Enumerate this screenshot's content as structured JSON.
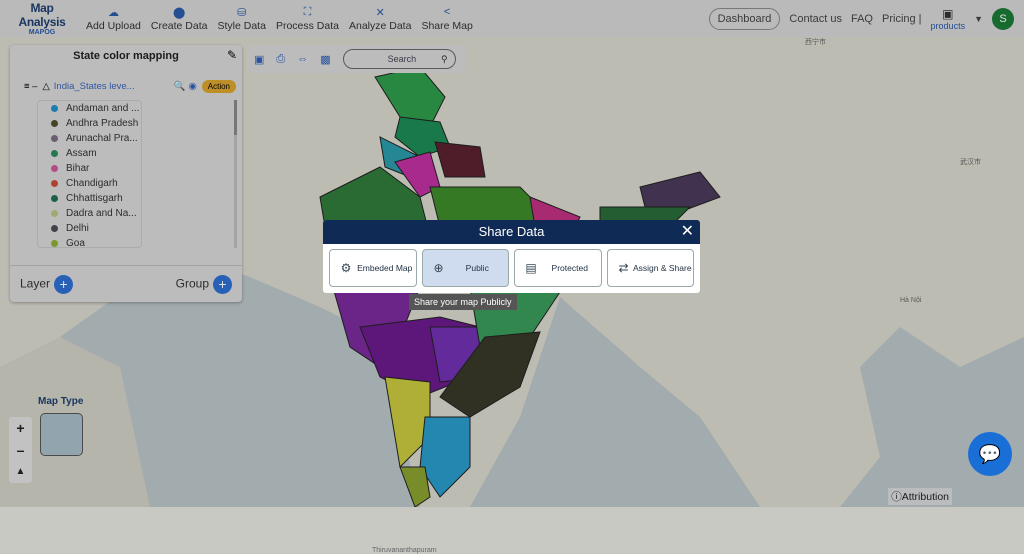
{
  "header": {
    "logo_title": "Map Analysis",
    "logo_sub": "MAPOG",
    "nav": [
      {
        "label": "Add Upload",
        "icon": "cloud-upload-icon"
      },
      {
        "label": "Create Data",
        "icon": "map-pin-icon"
      },
      {
        "label": "Style Data",
        "icon": "paint-bucket-icon"
      },
      {
        "label": "Process Data",
        "icon": "process-icon"
      },
      {
        "label": "Analyze Data",
        "icon": "analyze-icon"
      },
      {
        "label": "Share Map",
        "icon": "share-icon"
      }
    ],
    "dashboard": "Dashboard",
    "contact": "Contact us",
    "faq": "FAQ",
    "pricing": "Pricing |",
    "products": "products",
    "avatar": "S"
  },
  "panel": {
    "title": "State color mapping",
    "layer_name": "India_States leve...",
    "action": "Action",
    "legend": [
      {
        "label": "Andaman and ...",
        "color": "#1f8fc8"
      },
      {
        "label": "Andhra Pradesh",
        "color": "#4f4f2a"
      },
      {
        "label": "Arunachal Pra...",
        "color": "#7a6a80"
      },
      {
        "label": "Assam",
        "color": "#2a8a5a"
      },
      {
        "label": "Bihar",
        "color": "#d0559a"
      },
      {
        "label": "Chandigarh",
        "color": "#c84a3a"
      },
      {
        "label": "Chhattisgarh",
        "color": "#1e6e50"
      },
      {
        "label": "Dadra and Na...",
        "color": "#b8c080"
      },
      {
        "label": "Delhi",
        "color": "#4a4a55"
      },
      {
        "label": "Goa",
        "color": "#8ab030"
      }
    ],
    "layer_btn": "Layer",
    "group_btn": "Group"
  },
  "toolbar": {
    "search_placeholder": "Search"
  },
  "modal": {
    "title": "Share Data",
    "options": [
      {
        "label": "Embeded Map",
        "icon": "embed-icon"
      },
      {
        "label": "Public",
        "icon": "public-icon",
        "selected": true
      },
      {
        "label": "Protected",
        "icon": "protected-icon"
      },
      {
        "label": "Assign & Share",
        "icon": "assign-share-icon"
      }
    ],
    "tooltip": "Share your map Publicly"
  },
  "map": {
    "map_type": "Map Type",
    "attribution": "Attribution"
  }
}
